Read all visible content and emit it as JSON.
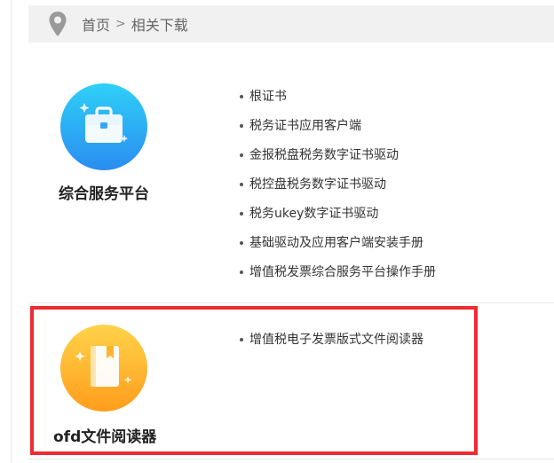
{
  "breadcrumb": {
    "home": "首页",
    "separator": ">",
    "current": "相关下载"
  },
  "sections": [
    {
      "title": "综合服务平台",
      "icon": "briefcase-icon",
      "icon_gradient": [
        "#2fd0f8",
        "#2a8df0"
      ],
      "items": [
        "根证书",
        "税务证书应用客户端",
        "金报税盘税务数字证书驱动",
        "税控盘税务数字证书驱动",
        "税务ukey数字证书驱动",
        "基础驱动及应用客户端安装手册",
        "增值税发票综合服务平台操作手册"
      ]
    },
    {
      "title": "ofd文件阅读器",
      "icon": "book-icon",
      "icon_gradient": [
        "#ffd34a",
        "#ff9d1b"
      ],
      "items": [
        "增值税电子发票版式文件阅读器"
      ]
    }
  ],
  "colors": {
    "highlight": "#ee2a32",
    "breadcrumb_bg": "#f1f1f1",
    "pin": "#9a9a9a"
  }
}
